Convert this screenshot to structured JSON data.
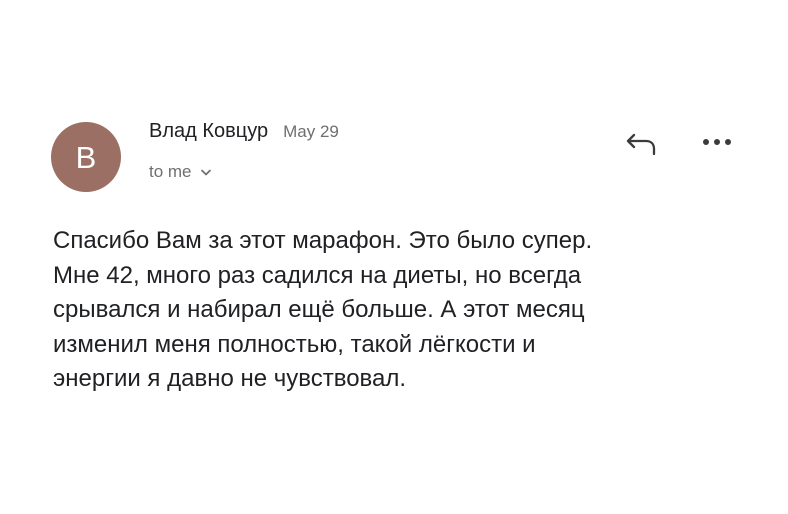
{
  "email": {
    "avatar_letter": "В",
    "avatar_color": "#9b6f63",
    "sender_name": "Влад Ковцур",
    "date": "May 29",
    "recipient_label": "to me",
    "body_lines": [
      "Спасибо Вам за этот марафон. Это было супер.",
      "Мне 42, много раз садился на диеты, но всегда",
      "срывался и набирал ещё больше. А этот месяц",
      "изменил меня полностью, такой лёгкости и",
      "энергии я давно не чувствовал."
    ]
  },
  "icons": {
    "recipient_toggle": "chevron-down-icon",
    "reply": "reply-icon",
    "more": "more-horizontal-icon"
  },
  "colors": {
    "text_primary": "#202124",
    "text_secondary": "#6f6f6f",
    "background": "#ffffff"
  }
}
